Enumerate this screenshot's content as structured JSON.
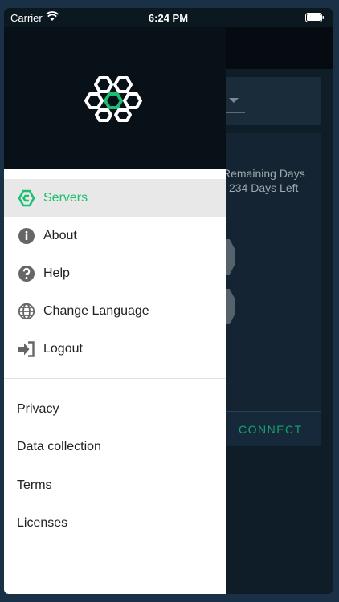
{
  "status_bar": {
    "carrier": "Carrier",
    "time": "6:24 PM"
  },
  "background": {
    "remaining_label": "Remaining Days",
    "days_left": "234 Days Left",
    "connect_label": "CONNECT"
  },
  "drawer": {
    "menu": [
      {
        "label": "Servers",
        "icon": "servers-hexagon-icon",
        "active": true
      },
      {
        "label": "About",
        "icon": "info-icon"
      },
      {
        "label": "Help",
        "icon": "help-icon"
      },
      {
        "label": "Change Language",
        "icon": "globe-icon"
      },
      {
        "label": "Logout",
        "icon": "logout-icon"
      }
    ],
    "links": [
      {
        "label": "Privacy"
      },
      {
        "label": "Data collection"
      },
      {
        "label": "Terms"
      },
      {
        "label": "Licenses"
      }
    ]
  },
  "colors": {
    "accent": "#1cbf72",
    "header_bg": "#081018"
  }
}
